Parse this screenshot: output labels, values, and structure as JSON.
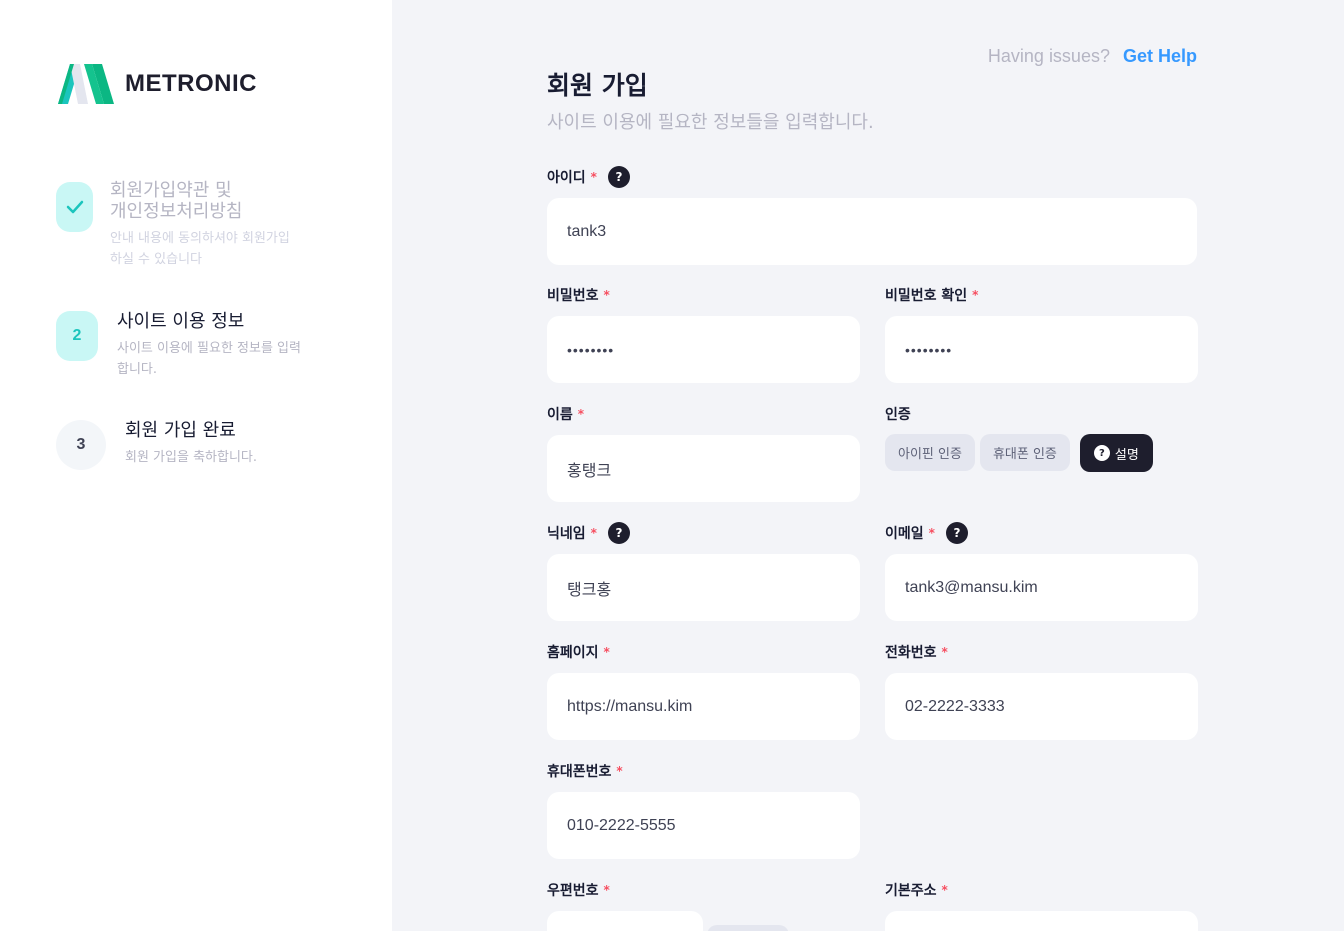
{
  "brand": {
    "name": "METRONIC"
  },
  "help": {
    "question": "Having issues?",
    "link": "Get Help"
  },
  "steps": [
    {
      "number": "",
      "title": "회원가입약관 및\n개인정보처리방침",
      "desc": "안내 내용에 동의하셔야 회원가입\n하실 수 있습니다",
      "state": "done"
    },
    {
      "number": "2",
      "title": "사이트 이용 정보",
      "desc": "사이트 이용에 필요한 정보를 입력\n합니다.",
      "state": "current"
    },
    {
      "number": "3",
      "title": "회원 가입 완료",
      "desc": "회원 가입을 축하합니다.",
      "state": "pending"
    }
  ],
  "form": {
    "title": "회원 가입",
    "subtitle": "사이트 이용에 필요한 정보들을 입력합니다.",
    "userid": {
      "label": "아이디",
      "value": "tank3"
    },
    "password": {
      "label": "비밀번호",
      "value": "••••••••"
    },
    "password_confirm": {
      "label": "비밀번호 확인",
      "value": "••••••••"
    },
    "name": {
      "label": "이름",
      "value": "홍탱크"
    },
    "auth": {
      "label": "인증",
      "ipin": "아이핀 인증",
      "phone": "휴대폰 인증",
      "explain": "설명"
    },
    "nickname": {
      "label": "닉네임",
      "value": "탱크홍"
    },
    "email": {
      "label": "이메일",
      "value": "tank3@mansu.kim"
    },
    "homepage": {
      "label": "홈페이지",
      "value": "https://mansu.kim"
    },
    "tel": {
      "label": "전화번호",
      "value": "02-2222-3333"
    },
    "mobile": {
      "label": "휴대폰번호",
      "value": "010-2222-5555"
    },
    "zipcode": {
      "label": "우편번호",
      "value": ""
    },
    "address": {
      "label": "기본주소",
      "value": ""
    },
    "required_mark": "*",
    "hint_glyph": "?"
  },
  "colors": {
    "accent": "#1BC5BD",
    "link": "#3699FF",
    "required": "#F64E60",
    "dark": "#1E1E2D"
  }
}
